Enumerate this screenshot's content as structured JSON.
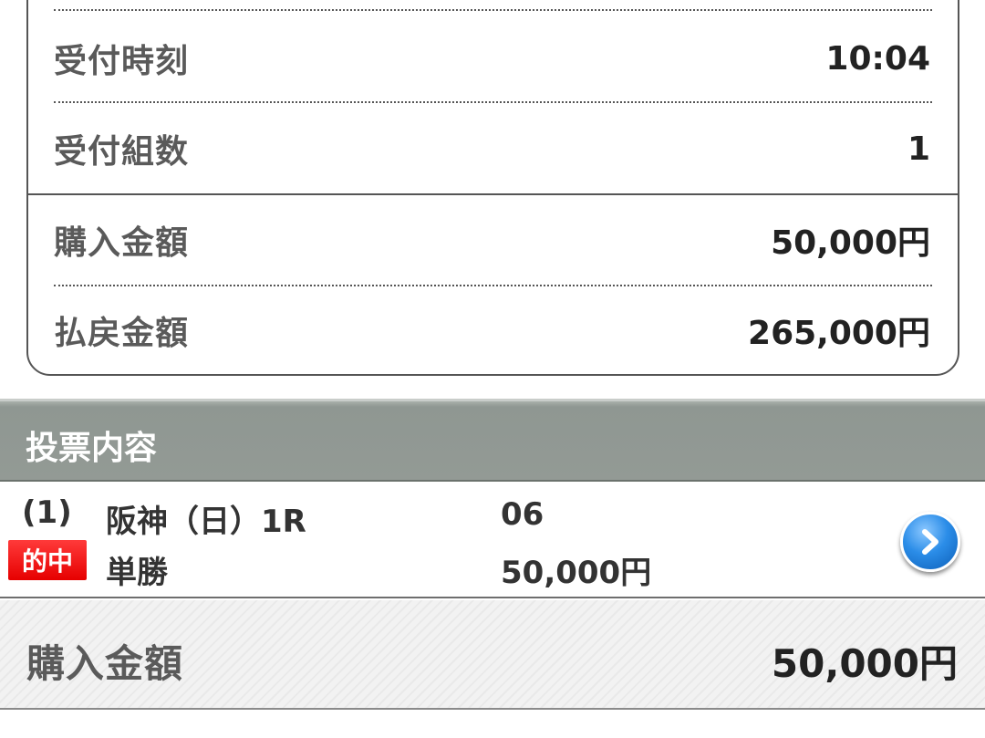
{
  "summary": {
    "rows": [
      {
        "label": "受付時刻",
        "value": "10:04"
      },
      {
        "label": "受付組数",
        "value": "1"
      },
      {
        "label": "購入金額",
        "value": "50,000円"
      },
      {
        "label": "払戻金額",
        "value": "265,000円"
      }
    ]
  },
  "section": {
    "title": "投票内容"
  },
  "bet": {
    "number": "(1)",
    "race": "阪神（日）1R",
    "horse": "06",
    "hit_badge": "的中",
    "bet_type": "単勝",
    "amount": "50,000円",
    "detail_icon": "chevron-right-icon"
  },
  "total": {
    "label": "購入金額",
    "value": "50,000円"
  },
  "colors": {
    "header_bg": "#939a95",
    "hit_badge": "#e60000",
    "detail_button": "#2b8de8"
  }
}
